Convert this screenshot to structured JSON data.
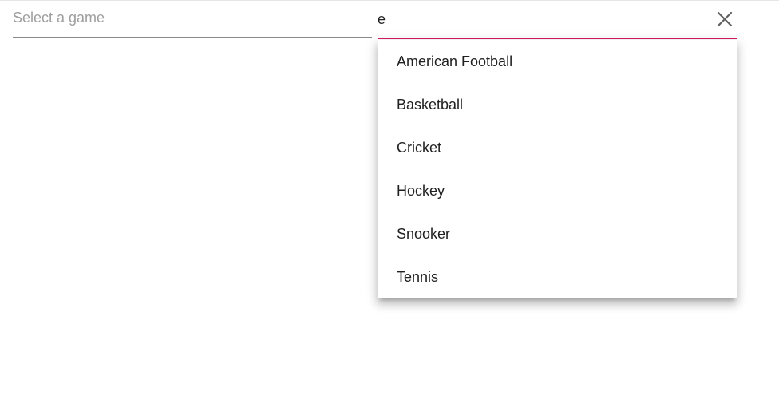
{
  "dropdown": {
    "placeholder": "Select a game"
  },
  "filter": {
    "value": "e",
    "clear_icon": "close-icon",
    "accent_color": "#d81b60"
  },
  "options": [
    {
      "label": "American Football"
    },
    {
      "label": "Basketball"
    },
    {
      "label": "Cricket"
    },
    {
      "label": "Hockey"
    },
    {
      "label": "Snooker"
    },
    {
      "label": "Tennis"
    }
  ]
}
